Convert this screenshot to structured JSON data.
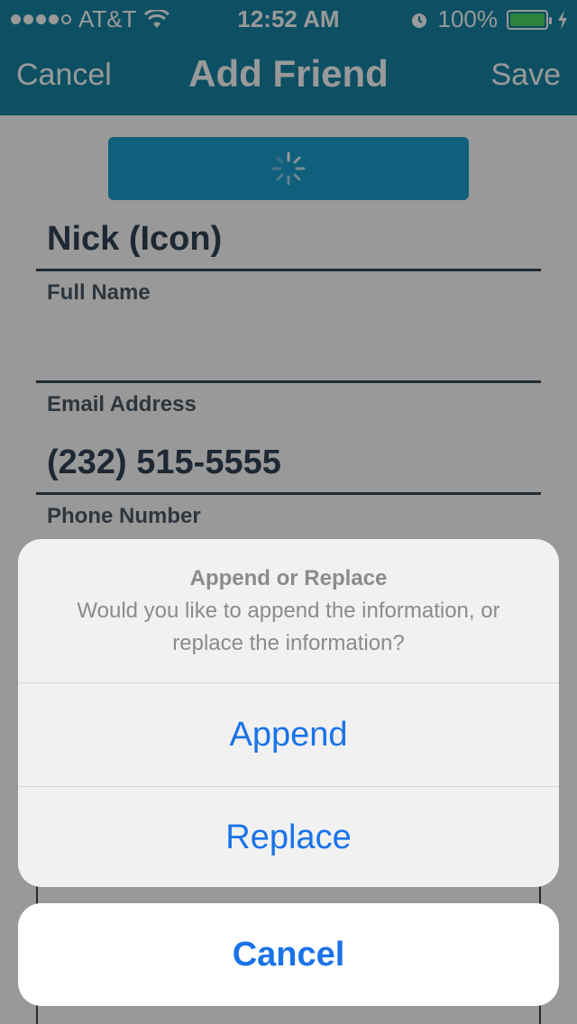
{
  "status_bar": {
    "carrier": "AT&T",
    "time": "12:52 AM",
    "battery": "100%",
    "signal_bars_filled": 4
  },
  "nav": {
    "cancel_label": "Cancel",
    "title": "Add Friend",
    "save_label": "Save"
  },
  "form": {
    "full_name_value": "Nick (Icon)",
    "full_name_label": "Full Name",
    "email_value": "",
    "email_label": "Email Address",
    "phone_value": "(232) 515-5555",
    "phone_label": "Phone Number"
  },
  "action_sheet": {
    "title": "Append or Replace",
    "message": "Would you like to append the information, or replace the information?",
    "append_label": "Append",
    "replace_label": "Replace",
    "cancel_label": "Cancel"
  },
  "colors": {
    "nav_bar": "#1685a6",
    "accent_button": "#1a9fd0",
    "action_text": "#1a73e8",
    "battery": "#4cd964"
  }
}
